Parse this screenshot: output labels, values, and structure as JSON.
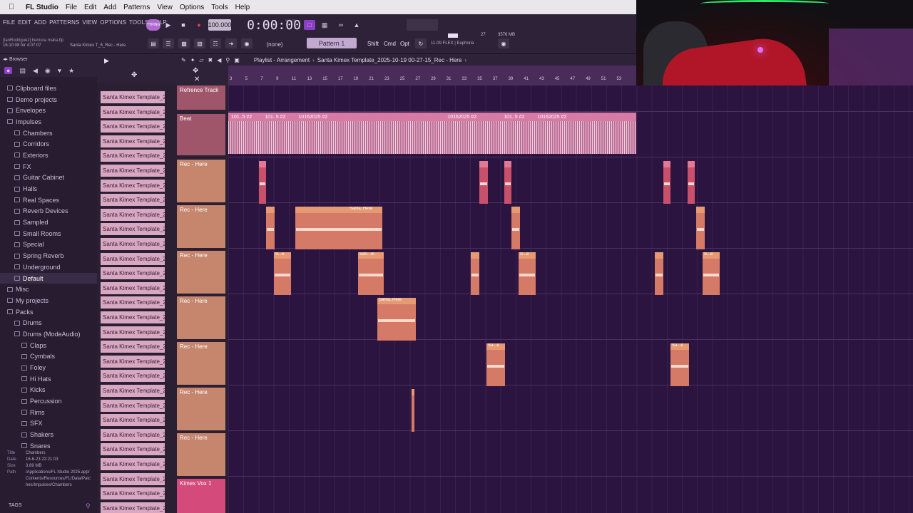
{
  "menubar": {
    "app": "FL Studio",
    "items": [
      "File",
      "Edit",
      "Add",
      "Patterns",
      "View",
      "Options",
      "Tools",
      "Help"
    ]
  },
  "fl": {
    "menu": [
      "FILE",
      "EDIT",
      "ADD",
      "PATTERNS",
      "VIEW",
      "OPTIONS",
      "TOOLS",
      "HELP"
    ],
    "file_line": "[tanRodriguez] hemora malia.flp",
    "edit_time": "16:10:08 for 4:07:07",
    "hint": "Santa Kimex T_6_Rec - Here",
    "typing": "TYPING",
    "tempo": "100.000",
    "time": "0:00:00",
    "msc": "M:S:CS",
    "snap": "(none)",
    "pattern": "Pattern 1",
    "keys": [
      "Shift",
      "Cmd",
      "Opt"
    ],
    "hintbar": "11-09  FLEX | Euphoria",
    "cpu_a": "27",
    "cpu_b": "3576 MB",
    "cpu_c": "0"
  },
  "browser": {
    "title": "Browser",
    "items": [
      {
        "label": "Clipboard files",
        "indent": 1
      },
      {
        "label": "Demo projects",
        "indent": 1
      },
      {
        "label": "Envelopes",
        "indent": 1
      },
      {
        "label": "Impulses",
        "indent": 1
      },
      {
        "label": "Chambers",
        "indent": 2
      },
      {
        "label": "Corridors",
        "indent": 2
      },
      {
        "label": "Exteriors",
        "indent": 2
      },
      {
        "label": "FX",
        "indent": 2
      },
      {
        "label": "Guitar Cabinet",
        "indent": 2
      },
      {
        "label": "Halls",
        "indent": 2
      },
      {
        "label": "Real Spaces",
        "indent": 2
      },
      {
        "label": "Reverb Devices",
        "indent": 2
      },
      {
        "label": "Sampled",
        "indent": 2
      },
      {
        "label": "Small Rooms",
        "indent": 2
      },
      {
        "label": "Special",
        "indent": 2
      },
      {
        "label": "Spring Reverb",
        "indent": 2
      },
      {
        "label": "Underground",
        "indent": 2
      },
      {
        "label": "Default",
        "indent": 2
      },
      {
        "label": "Misc",
        "indent": 1
      },
      {
        "label": "My projects",
        "indent": 1
      },
      {
        "label": "Packs",
        "indent": 1
      },
      {
        "label": "Drums",
        "indent": 2
      },
      {
        "label": "Drums (ModeAudio)",
        "indent": 2
      },
      {
        "label": "Claps",
        "indent": 3
      },
      {
        "label": "Cymbals",
        "indent": 3
      },
      {
        "label": "Foley",
        "indent": 3
      },
      {
        "label": "Hi Hats",
        "indent": 3
      },
      {
        "label": "Kicks",
        "indent": 3
      },
      {
        "label": "Percussion",
        "indent": 3
      },
      {
        "label": "Rims",
        "indent": 3
      },
      {
        "label": "SFX",
        "indent": 3
      },
      {
        "label": "Shakers",
        "indent": 3
      },
      {
        "label": "Snares",
        "indent": 3
      }
    ],
    "info": {
      "title_k": "Title",
      "title": "Chambers",
      "date_k": "Date",
      "date": "16-6-23 22:21:03",
      "size_k": "Size",
      "size": "3.89 MB",
      "path_k": "Path",
      "path": "/Applications/FL Studio 2025.app/Contents/Resources/FL/Data/Patches/Impulses/Chambers"
    },
    "tags": "TAGS"
  },
  "clip_label": "Santa Kimex Template_2...",
  "playlist": {
    "title": "Playlist - Arrangement",
    "name": "Santa Kimex Template_2025-10-19 00-27-15_Rec - Here",
    "ruler": [
      "3",
      "5",
      "7",
      "9",
      "11",
      "13",
      "15",
      "17",
      "19",
      "21",
      "23",
      "25",
      "27",
      "29",
      "31",
      "33",
      "35",
      "37",
      "39",
      "41",
      "43",
      "45",
      "47",
      "49",
      "51",
      "53"
    ],
    "tracks": [
      "Refrence Track",
      "Beat",
      "Rec - Here",
      "Rec - Here",
      "Rec - Here",
      "Rec - Here",
      "Rec - Here",
      "Rec - Here",
      "Rec - Here"
    ],
    "beat_clip_labels": [
      "101..5 #2",
      "101..5 #2",
      "10162025 #2",
      "10162025 #2",
      "101..5 #2",
      "10162025 #2"
    ],
    "vox": "Kimex Vox 1",
    "clip_names": {
      "long": "Santa..Here",
      "s1": "San...re",
      "s2": "S...e",
      "s3": "Sa...e"
    }
  }
}
